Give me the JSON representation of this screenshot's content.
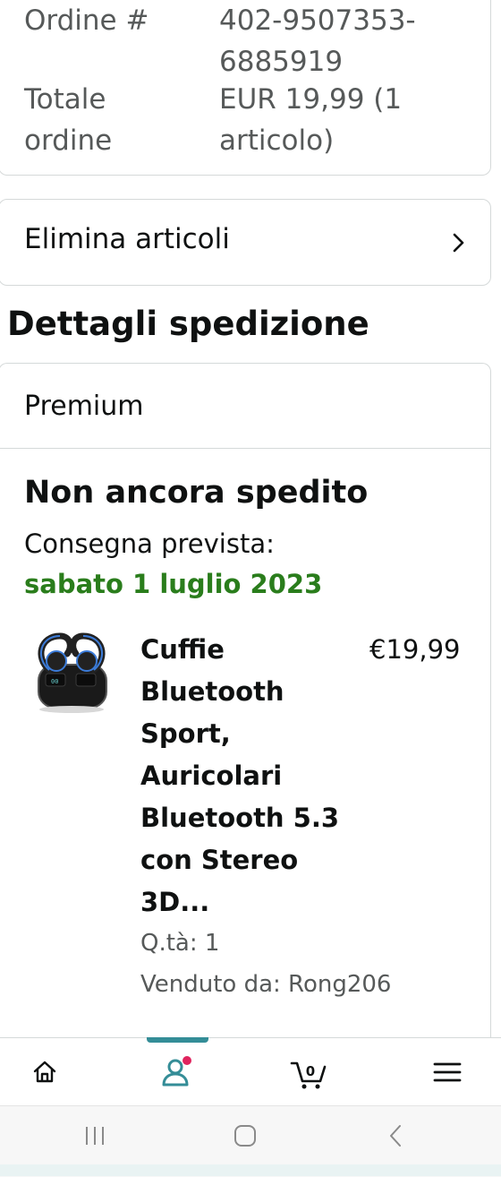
{
  "order": {
    "number_label": "Ordine #",
    "number_value_line1": "402-9507353-",
    "number_value_line2": "6885919",
    "total_label_line1": "Totale",
    "total_label_line2": "ordine",
    "total_value_line1": "EUR 19,99 (1",
    "total_value_line2": "articolo)"
  },
  "actions": {
    "delete_items": "Elimina articoli"
  },
  "shipping": {
    "title": "Dettagli spedizione",
    "program": "Premium",
    "status": "Non ancora spedito",
    "eta_label": "Consegna prevista:",
    "eta_date": "sabato 1 luglio 2023",
    "eta_color": "#2a7d1c"
  },
  "product": {
    "title_lines": [
      "Cuffie",
      "Bluetooth",
      "Sport,",
      "Auricolari",
      "Bluetooth 5.3",
      "con Stereo",
      "3D..."
    ],
    "price": "€19,99",
    "quantity": "Q.tà: 1",
    "seller": "Venduto da: Rong206"
  },
  "bottom_nav": {
    "items": [
      {
        "icon": "home-icon"
      },
      {
        "icon": "account-icon",
        "active": true,
        "badge_color": "#e0245e"
      },
      {
        "icon": "cart-icon",
        "count": "0"
      },
      {
        "icon": "menu-icon"
      }
    ],
    "accent_color": "#348d97"
  },
  "system_nav": {
    "items": [
      "recent-apps-icon",
      "home-button-icon",
      "back-icon"
    ]
  }
}
